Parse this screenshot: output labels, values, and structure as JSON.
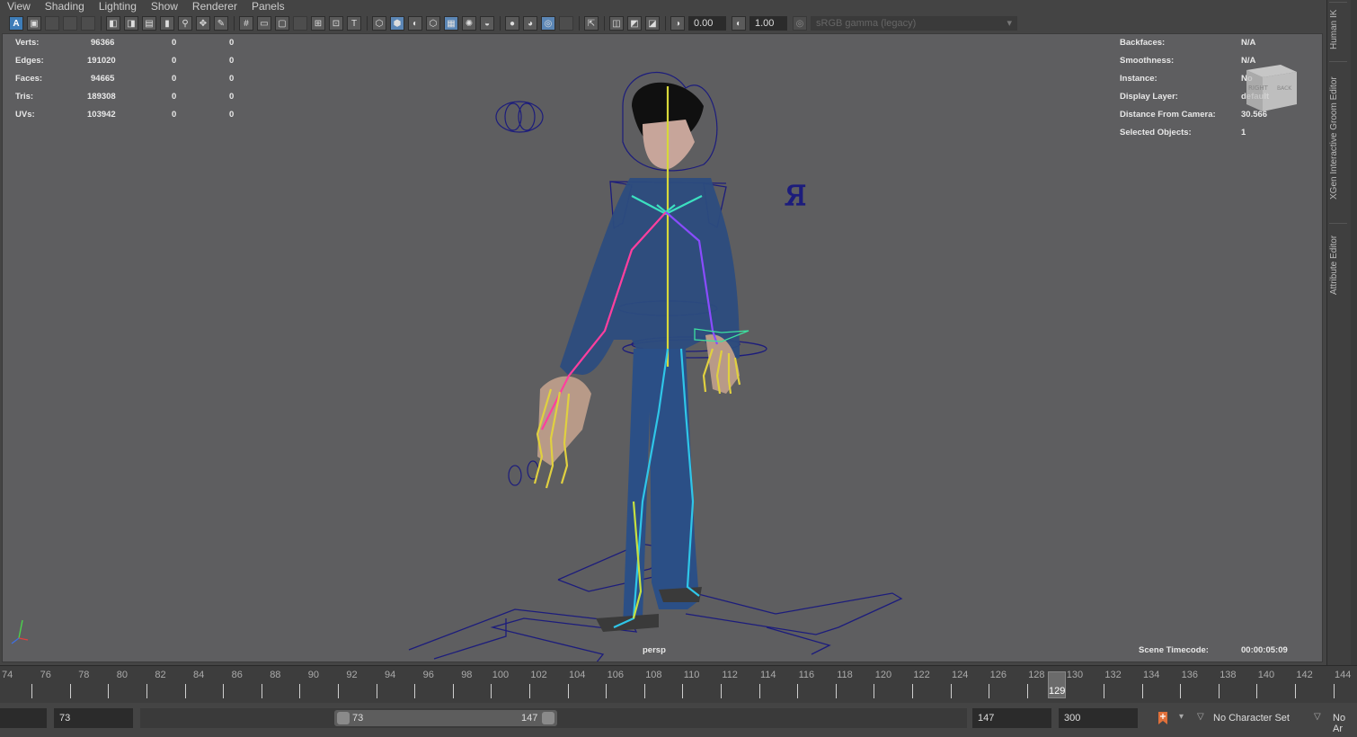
{
  "menu": [
    "View",
    "Shading",
    "Lighting",
    "Show",
    "Renderer",
    "Panels"
  ],
  "toolbar": {
    "exposure": "0.00",
    "gamma": "1.00",
    "color_space": "sRGB gamma (legacy)"
  },
  "hud_left": [
    {
      "label": "Verts:",
      "value": "96366",
      "a": "0",
      "b": "0"
    },
    {
      "label": "Edges:",
      "value": "191020",
      "a": "0",
      "b": "0"
    },
    {
      "label": "Faces:",
      "value": "94665",
      "a": "0",
      "b": "0"
    },
    {
      "label": "Tris:",
      "value": "189308",
      "a": "0",
      "b": "0"
    },
    {
      "label": "UVs:",
      "value": "103942",
      "a": "0",
      "b": "0"
    }
  ],
  "hud_right": [
    {
      "label": "Backfaces:",
      "value": "N/A"
    },
    {
      "label": "Smoothness:",
      "value": "N/A"
    },
    {
      "label": "Instance:",
      "value": "No"
    },
    {
      "label": "Display Layer:",
      "value": "default"
    },
    {
      "label": "Distance From Camera:",
      "value": "30.566"
    },
    {
      "label": "Selected Objects:",
      "value": "1"
    }
  ],
  "viewcube": {
    "face_left": "RIGHT",
    "face_right": "BACK"
  },
  "camera_label": "persp",
  "timecode": {
    "label": "Scene Timecode:",
    "value": "00:00:05:09"
  },
  "right_tabs": [
    "Human IK",
    "XGen Interactive Groom Editor",
    "Attribute Editor"
  ],
  "timeline": {
    "ticks": [
      "74",
      "76",
      "78",
      "80",
      "82",
      "84",
      "86",
      "88",
      "90",
      "92",
      "94",
      "96",
      "98",
      "100",
      "102",
      "104",
      "106",
      "108",
      "110",
      "112",
      "114",
      "116",
      "118",
      "120",
      "122",
      "124",
      "126",
      "128",
      "130",
      "132",
      "134",
      "136",
      "138",
      "140",
      "142",
      "144"
    ],
    "current_frame": "129"
  },
  "range": {
    "start_field": "73",
    "range_start": "73",
    "range_end": "147",
    "end_field": "147",
    "anim_end": "300",
    "character_set": "No Character Set",
    "anim_layer": "No Ar"
  },
  "colors": {
    "viewport_bg": "#5e5e60",
    "rig_control": "#1a1a7a",
    "body": "#2c4c7e",
    "spine": "#d8d83a",
    "arm_left": "#ff3f9e",
    "arm_right": "#8a4cff",
    "leg": "#2fc6e8"
  }
}
